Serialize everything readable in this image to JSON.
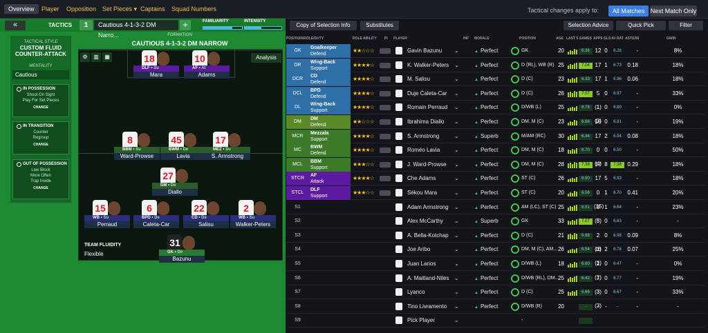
{
  "nav": {
    "tabs": [
      "Overview",
      "Player",
      "Opposition",
      "Set Pieces ▾",
      "Captains",
      "Squad Numbers"
    ],
    "apply_text": "Tactical changes apply to:",
    "all_matches": "All Matches",
    "next_match": "Next Match Only"
  },
  "tactics_bar": {
    "back": "«",
    "tactics_label": "TACTICS",
    "slot": "1",
    "name": "Cautious 4-1-3-2 DM Narro...",
    "add": "+",
    "familiarity_label": "FAMILIARITY",
    "intensity_label": "INTENSITY",
    "familiarity": 0.75,
    "intensity": 0.45
  },
  "sidebar": {
    "style_label": "TACTICAL STYLE",
    "style_value": "CUSTOM FLUID COUNTER-ATTACK",
    "mentality_label": "MENTALITY",
    "mentality_value": "Cautious",
    "in_possession": {
      "title": "IN POSSESSION",
      "items": [
        "Shoot On Sight",
        "Play For Set Pieces"
      ],
      "change": "CHANGE"
    },
    "in_transition": {
      "title": "IN TRANSITION",
      "items": [
        "Counter",
        "Regroup"
      ],
      "change": "CHANGE"
    },
    "out_of_possession": {
      "title": "OUT OF POSSESSION",
      "items": [
        "Low Block",
        "More Often",
        "Trap Inside"
      ],
      "change": "CHANGE"
    }
  },
  "formation": {
    "label": "FORMATION",
    "name": "CAUTIOUS 4-1-3-2 DM NARROW",
    "analysis": "Analysis",
    "fluidity_label": "TEAM FLUIDITY",
    "fluidity_value": "Flexible"
  },
  "pitch_players": [
    {
      "num": "18",
      "role": "DLF",
      "duty": "Su",
      "name": "Mara",
      "shirt": "white",
      "roleclass": "atk"
    },
    {
      "num": "10",
      "role": "AF",
      "duty": "At",
      "name": "Adams",
      "shirt": "white",
      "roleclass": "atk"
    },
    {
      "num": "8",
      "role": "BBM",
      "duty": "Su",
      "name": "Ward-Prowse",
      "shirt": "white",
      "roleclass": "mid"
    },
    {
      "num": "45",
      "role": "BWM",
      "duty": "De",
      "name": "Lavia",
      "shirt": "white",
      "roleclass": "mid"
    },
    {
      "num": "17",
      "role": "MEZ",
      "duty": "Su",
      "name": "S. Armstrong",
      "shirt": "white",
      "roleclass": "mid"
    },
    {
      "num": "27",
      "role": "DM",
      "duty": "De",
      "name": "Diallo",
      "shirt": "white",
      "roleclass": "mid"
    },
    {
      "num": "15",
      "role": "WB",
      "duty": "Su",
      "name": "Perraud",
      "shirt": "white",
      "roleclass": ""
    },
    {
      "num": "6",
      "role": "BPD",
      "duty": "De",
      "name": "Caleta-Car",
      "shirt": "white",
      "roleclass": ""
    },
    {
      "num": "22",
      "role": "CD",
      "duty": "De",
      "name": "Salisu",
      "shirt": "white",
      "roleclass": ""
    },
    {
      "num": "2",
      "role": "WB",
      "duty": "Su",
      "name": "Walker-Peters",
      "shirt": "white",
      "roleclass": ""
    },
    {
      "num": "31",
      "role": "GK",
      "duty": "De",
      "name": "Bazunu",
      "shirt": "black",
      "roleclass": "gk"
    }
  ],
  "toolbar": {
    "copy": "Copy of Selection Info",
    "substitutes": "Substitutes",
    "advice": "Selection Advice",
    "quick_pick": "Quick Pick",
    "filter": "Filter"
  },
  "columns": [
    "POSITION/ROLE/DUTY",
    "ROLE ABILITY",
    "PI",
    "PLAYER",
    "INF",
    "MORALE",
    "POSITION",
    "AGE",
    "LAST 5 GAMES",
    "APPS",
    "GLS",
    "AV RAT",
    "ASTS/90",
    "GWIN"
  ],
  "rows": [
    {
      "pos": "GK",
      "role": "Goalkeeper",
      "duty": "Defend",
      "stars": "★★☆☆☆",
      "player": "Gavin Bazunu",
      "morale": "Perfect",
      "ppos": "GK",
      "age": "20",
      "avr": "6.36",
      "apps": "12",
      "gls": "0",
      "av2": "6.26",
      "xg": "-",
      "gwin": "8%",
      "color": "#2f6fa8"
    },
    {
      "pos": "DR",
      "role": "Wing-Back",
      "duty": "Support",
      "stars": "★★★★☆",
      "player": "K. Walker-Peters",
      "morale": "Perfect",
      "ppos": "D (RL), WB (R)",
      "age": "25",
      "avr": "7.04",
      "apps": "17",
      "gls": "1",
      "av2": "6.73",
      "xg": "0.18",
      "gwin": "18%",
      "color": "#2f6fa8"
    },
    {
      "pos": "DCR",
      "role": "CD",
      "duty": "Defend",
      "stars": "★★★★☆",
      "player": "M. Salisu",
      "morale": "Perfect",
      "ppos": "D (C)",
      "age": "23",
      "avr": "6.33",
      "apps": "17",
      "gls": "1",
      "av2": "6.96",
      "xg": "0.06",
      "gwin": "18%",
      "color": "#2f6fa8"
    },
    {
      "pos": "DCL",
      "role": "BPD",
      "duty": "Defend",
      "stars": "★★★★☆",
      "player": "Duje Ćaleta-Car",
      "morale": "Perfect",
      "ppos": "D (C)",
      "age": "26",
      "avr": "7.07",
      "apps": "5 (1)",
      "gls": "0",
      "av2": "6.97",
      "xg": "-",
      "gwin": "33%",
      "color": "#2f6fa8"
    },
    {
      "pos": "DL",
      "role": "Wing-Back",
      "duty": "Support",
      "stars": "★★★★☆",
      "player": "Romain Perraud",
      "morale": "Perfect",
      "ppos": "D/WB (L)",
      "age": "25",
      "avr": "6.78",
      "apps": "1 (3)",
      "gls": "0",
      "av2": "6.80",
      "xg": "-",
      "gwin": "0%",
      "color": "#2f6fa8"
    },
    {
      "pos": "DM",
      "role": "DM",
      "duty": "Defend",
      "stars": "★★☆☆☆",
      "player": "Ibrahima Diallo",
      "morale": "Perfect",
      "ppos": "DM, M (C)",
      "age": "23",
      "avr": "6.66",
      "apps": "16",
      "gls": "0",
      "av2": "6.81",
      "xg": "-",
      "gwin": "19%",
      "color": "#5b8a2a"
    },
    {
      "pos": "MCR",
      "role": "Mezzala",
      "duty": "Support",
      "stars": "★★★★☆",
      "player": "S. Armstrong",
      "morale": "Superb",
      "ppos": "M/AM (RC)",
      "age": "30",
      "avr": "6.44",
      "apps": "17",
      "gls": "2",
      "av2": "6.94",
      "xg": "0.08",
      "gwin": "18%",
      "color": "#3c7a2a"
    },
    {
      "pos": "MC",
      "role": "BWM",
      "duty": "Defend",
      "stars": "★★★★☆",
      "player": "Roméo Lavia",
      "morale": "Perfect",
      "ppos": "DM, M (C)",
      "age": "18",
      "avr": "6.70",
      "apps": "0 (4)",
      "gls": "0",
      "av2": "6.50",
      "xg": "-",
      "gwin": "50%",
      "color": "#3c7a2a"
    },
    {
      "pos": "MCL",
      "role": "BBM",
      "duty": "Support",
      "stars": "★★★☆☆",
      "player": "J. Ward-Prowse",
      "morale": "Perfect",
      "ppos": "DM, M (C)",
      "age": "28",
      "avr": "7.38",
      "apps": "17",
      "gls": "8",
      "av2": "7.38",
      "xg": "0.29",
      "gwin": "18%",
      "color": "#3c7a2a"
    },
    {
      "pos": "STCR",
      "role": "AF",
      "duty": "Attack",
      "stars": "★★★★☆",
      "player": "Che Adams",
      "morale": "Perfect",
      "ppos": "ST (C)",
      "age": "26",
      "avr": "6.50",
      "apps": "17",
      "gls": "5",
      "av2": "6.93",
      "xg": "-",
      "gwin": "18%",
      "color": "#5b1aa0"
    },
    {
      "pos": "STCL",
      "role": "DLF",
      "duty": "Support",
      "stars": "★★★☆☆",
      "player": "Sékou Mara",
      "morale": "Perfect",
      "ppos": "ST (C)",
      "age": "20",
      "avr": "6.56",
      "apps": "0 (15)",
      "gls": "1",
      "av2": "6.70",
      "xg": "0.41",
      "gwin": "20%",
      "color": "#5b1aa0"
    },
    {
      "pos": "S1",
      "role": "",
      "duty": "",
      "stars": "",
      "player": "Adam Armstrong",
      "morale": "Perfect",
      "ppos": "AM (LC), ST (C)",
      "age": "25",
      "avr": "6.51",
      "apps": "8 (3)",
      "gls": "1",
      "av2": "6.64",
      "xg": "-",
      "gwin": "23%",
      "color": ""
    },
    {
      "pos": "S2",
      "role": "",
      "duty": "",
      "stars": "",
      "player": "Alex McCarthy",
      "morale": "Superb",
      "ppos": "GK",
      "age": "33",
      "avr": "7.07",
      "apps": "5",
      "gls": "0",
      "av2": "6.63",
      "xg": "-",
      "gwin": "-",
      "color": ""
    },
    {
      "pos": "S3",
      "role": "",
      "duty": "",
      "stars": "",
      "player": "A. Bella-Kotchap",
      "morale": "Perfect",
      "ppos": "D (C)",
      "age": "21",
      "avr": "6.98",
      "apps": "2 (1)",
      "gls": "0",
      "av2": "6.98",
      "xg": "0.09",
      "gwin": "8%",
      "color": ""
    },
    {
      "pos": "S4",
      "role": "",
      "duty": "",
      "stars": "",
      "player": "Joe Aribo",
      "morale": "Perfect",
      "ppos": "DM, M (C), AM...",
      "age": "26",
      "avr": "6.54",
      "apps": "16 (1)",
      "gls": "2",
      "av2": "6.78",
      "xg": "0.07",
      "gwin": "25%",
      "color": ""
    },
    {
      "pos": "S5",
      "role": "",
      "duty": "",
      "stars": "",
      "player": "Juan Larios",
      "morale": "Perfect",
      "ppos": "D/WB (L)",
      "age": "18",
      "avr": "6.60",
      "apps": "2 (1)",
      "gls": "0",
      "av2": "6.47",
      "xg": "-",
      "gwin": "0%",
      "color": ""
    },
    {
      "pos": "S6",
      "role": "",
      "duty": "",
      "stars": "",
      "player": "A. Maitland-Niles",
      "morale": "Perfect",
      "ppos": "D/WB (RL), DM...",
      "age": "25",
      "avr": "6.42",
      "apps": "7 (3)",
      "gls": "0",
      "av2": "6.77",
      "xg": "-",
      "gwin": "19%",
      "color": ""
    },
    {
      "pos": "S7",
      "role": "",
      "duty": "",
      "stars": "",
      "player": "Lyanco",
      "morale": "Perfect",
      "ppos": "D (C)",
      "age": "25",
      "avr": "6.66",
      "apps": "3 (3)",
      "gls": "0",
      "av2": "6.67",
      "xg": "-",
      "gwin": "33%",
      "color": ""
    },
    {
      "pos": "S8",
      "role": "",
      "duty": "",
      "stars": "",
      "player": "Tino Livramento",
      "morale": "Perfect",
      "ppos": "D/WB (R)",
      "age": "20",
      "avr": "-",
      "apps": "-",
      "gls": "-",
      "av2": "-",
      "xg": "-",
      "gwin": "-",
      "color": ""
    },
    {
      "pos": "S9",
      "role": "",
      "duty": "",
      "stars": "",
      "player": "Pick Player",
      "morale": "",
      "ppos": "-",
      "age": "",
      "avr": "",
      "apps": "",
      "gls": "",
      "av2": "",
      "xg": "",
      "gwin": "",
      "color": ""
    }
  ]
}
